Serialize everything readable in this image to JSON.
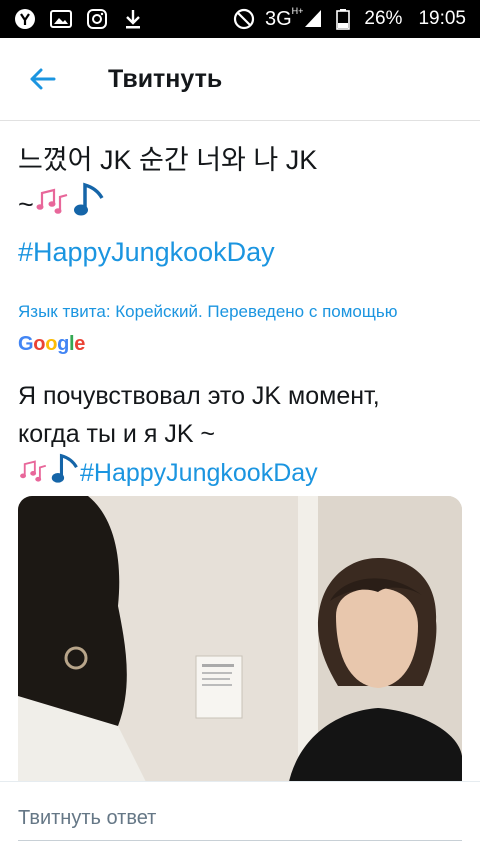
{
  "status_bar": {
    "network": "3G",
    "network_sup": "H+",
    "battery": "26%",
    "time": "19:05"
  },
  "app_bar": {
    "title": "Твитнуть"
  },
  "tweet": {
    "line1": "느꼈어 JK 순간 너와 나 JK",
    "line2_prefix": "~",
    "hashtag": "#HappyJungkookDay",
    "translation_label": "Язык твита: Корейский. Переведено с помощью",
    "translation_provider": "Google",
    "translated_line1": "Я почувствовал это JK момент,",
    "translated_line2": "когда ты и я JK ~",
    "translated_hashtag": "#HappyJungkookDay"
  },
  "reply": {
    "placeholder": "Твитнуть ответ"
  },
  "colors": {
    "accent": "#1b95e0",
    "text": "#14171a",
    "secondary": "#657786"
  }
}
